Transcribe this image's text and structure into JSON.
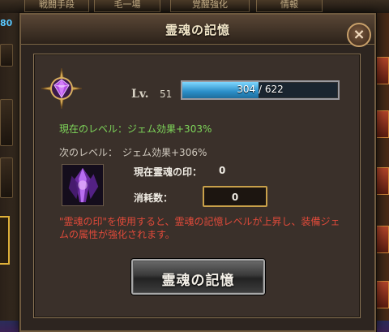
{
  "background": {
    "tabs": [
      "戦闘手段",
      "毛一場",
      "覚醒強化",
      "情報"
    ],
    "left_counter": "80"
  },
  "dialog": {
    "title": "霊魂の記憶",
    "close_label": "×",
    "level_prefix": "Lv.",
    "level": "51",
    "progress": {
      "text": "304 / 622",
      "current": 304,
      "max": 622,
      "fill_color": "#2a8ec8"
    },
    "current_level_text": "現在のレベル：ジェム効果+303%",
    "next_level_text": "次のレベル：　ジェム効果+306%",
    "seal_label": "現在霊魂の印：",
    "seal_count": "0",
    "consume_label": "消耗数：",
    "consume_value": "0",
    "description": "\"霊魂の印\"を使用すると、霊魂の記憶レベルが上昇し、装備ジェムの属性が強化されます。",
    "action_button": "霊魂の記憶",
    "colors": {
      "current_level": "#7ed65a",
      "description": "#e04a3a",
      "accent_gold": "#c8a04a"
    },
    "icons": {
      "emblem": "purple-gem-compass-icon",
      "seal": "soul-seal-crystal-icon",
      "close": "close-icon"
    }
  }
}
